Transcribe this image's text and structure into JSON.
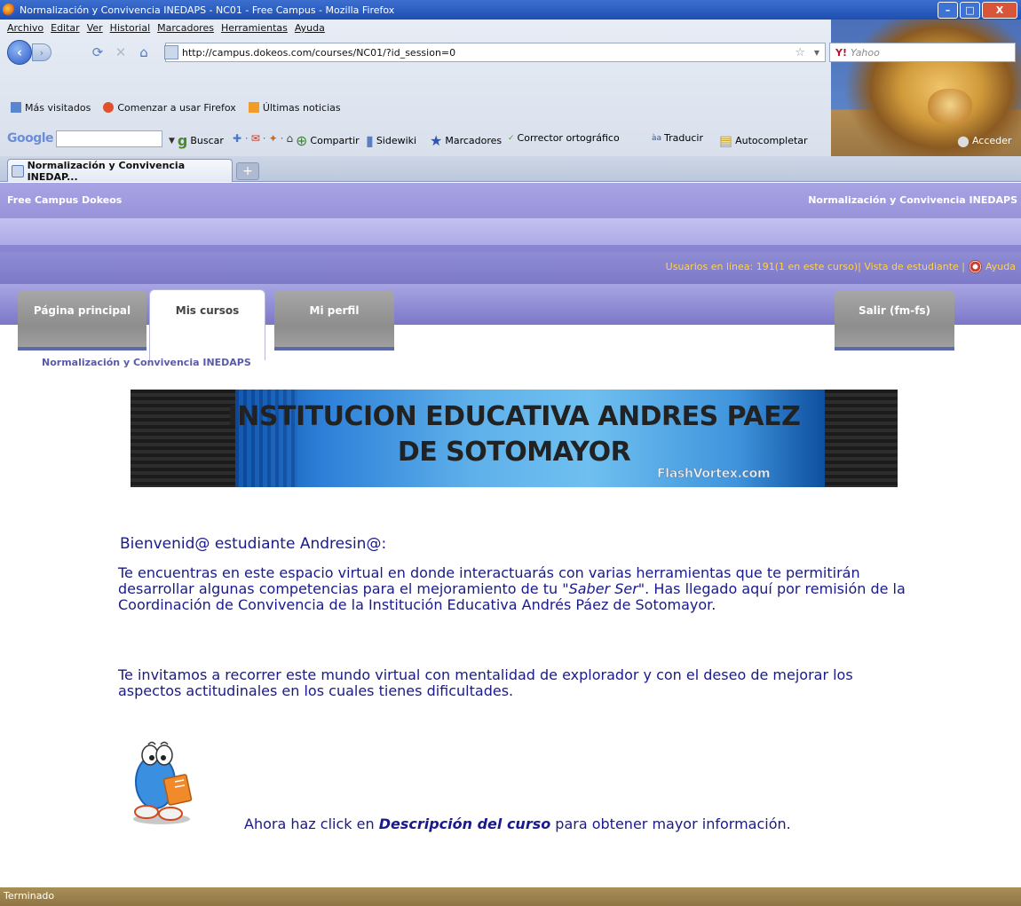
{
  "window": {
    "title": "Normalización y Convivencia INEDAPS - NC01 - Free Campus - Mozilla Firefox",
    "min_label": "–",
    "max_label": "□",
    "close_label": "X"
  },
  "menu": [
    "Archivo",
    "Editar",
    "Ver",
    "Historial",
    "Marcadores",
    "Herramientas",
    "Ayuda"
  ],
  "nav": {
    "url": "http://campus.dokeos.com/courses/NC01/?id_session=0",
    "search_placeholder": "Yahoo",
    "search_engine": "Y!"
  },
  "bookmarks": [
    "Más visitados",
    "Comenzar a usar Firefox",
    "Últimas noticias"
  ],
  "google_toolbar": {
    "logo": "Google",
    "items": [
      "Buscar",
      "Compartir",
      "Sidewiki",
      "Marcadores",
      "Corrector ortográfico",
      "Traducir",
      "Autocompletar",
      "Acceder"
    ]
  },
  "tabs": [
    {
      "label": "Normalización y Convivencia INEDAP..."
    }
  ],
  "newtab_label": "+",
  "site": {
    "name": "Free Campus  Dokeos",
    "course_header": "Normalización y Convivencia INEDAPS",
    "online_text": "Usuarios en línea: 191(1 en este curso)| Vista de estudiante |",
    "help_label": "Ayuda"
  },
  "main_tabs": [
    {
      "label": "Página principal",
      "active": false
    },
    {
      "label": "Mis cursos",
      "active": true
    },
    {
      "label": "Mi perfil",
      "active": false
    },
    {
      "label": "Salir (fm-fs)",
      "active": false
    }
  ],
  "breadcrumb": "Normalización y Convivencia INEDAPS",
  "institution_banner": {
    "line1": "INSTITUCION EDUCATIVA ANDRES PAEZ",
    "line2": "DE SOTOMAYOR",
    "watermark": "FlashVortex.com"
  },
  "content": {
    "welcome": "Bienvenid@ estudiante Andresin@:",
    "p1_a": "Te encuentras en este espacio virtual en donde interactuarás con varias herramientas que te permitirán desarrollar algunas competencias para el mejoramiento de tu ",
    "p1_em": "\"Saber Ser\"",
    "p1_b": ". Has llegado aquí por remisión de la Coordinación de Convivencia de la Institución Educativa Andrés Páez de Sotomayor.",
    "p2": "Te invitamos a recorrer este mundo virtual con mentalidad de explorador y con el deseo de mejorar los aspectos actitudinales en los cuales tienes dificultades.",
    "cta_a": "Ahora haz click en ",
    "cta_link": "Descripción del curso",
    "cta_b": " para obtener mayor información."
  },
  "statusbar": "Terminado",
  "colors": {
    "text_blue": "#1a1a8a",
    "header_purple": "#8c87d4",
    "highlight_yellow": "#ffd24d",
    "statusbar": "#9a804d"
  }
}
